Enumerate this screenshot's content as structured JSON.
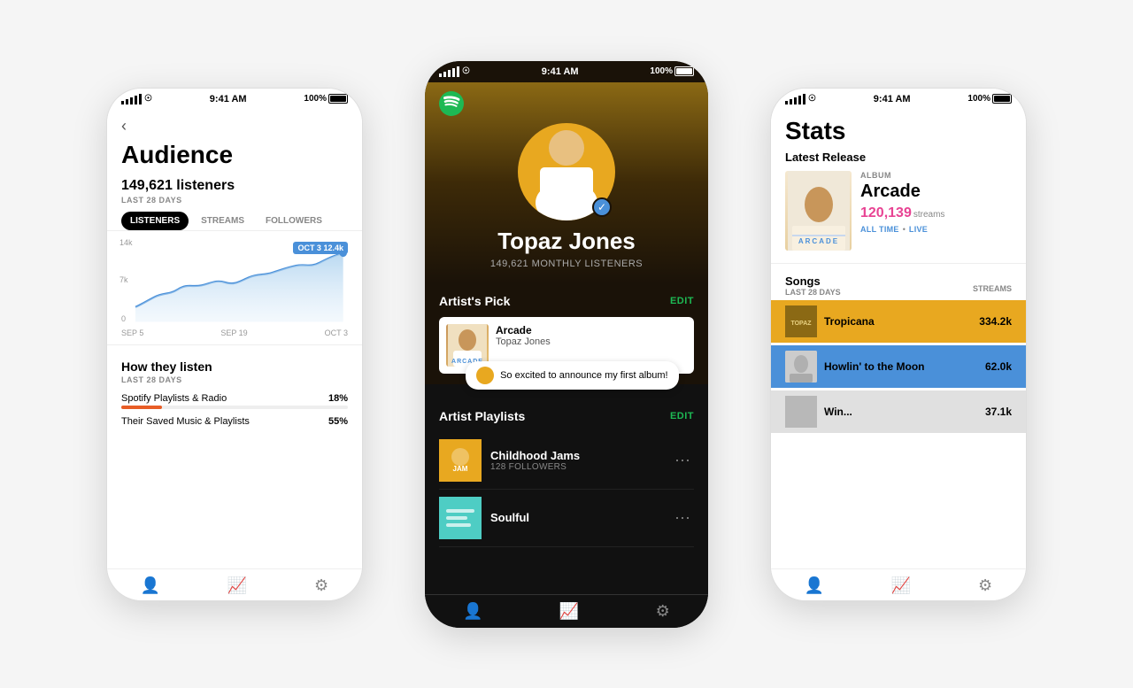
{
  "left_phone": {
    "status_bar": {
      "dots": "•••••",
      "wifi": "wifi",
      "time": "9:41 AM",
      "battery": "100%"
    },
    "back_label": "‹",
    "title": "Audience",
    "listeners_count": "149,621 listeners",
    "last_28_label": "LAST 28 DAYS",
    "tabs": [
      "LISTENERS",
      "STREAMS",
      "FOLLOWERS"
    ],
    "active_tab": "LISTENERS",
    "chart": {
      "y_labels": [
        "14k",
        "7k",
        "0"
      ],
      "x_labels": [
        "SEP 5",
        "SEP 19",
        "OCT 3"
      ],
      "tooltip_date": "OCT 3",
      "tooltip_value": "12.4k"
    },
    "how_they_listen": {
      "title": "How they listen",
      "last_28": "LAST 28 DAYS",
      "items": [
        {
          "label": "Spotify Playlists & Radio",
          "pct": "18%",
          "fill": 18,
          "color": "orange"
        },
        {
          "label": "Their Saved Music & Playlists",
          "pct": "55%",
          "fill": 55,
          "color": "green"
        }
      ]
    },
    "nav": [
      "person",
      "chart",
      "gear"
    ]
  },
  "center_phone": {
    "status_bar": {
      "dots": "•••••",
      "wifi": "wifi",
      "time": "9:41 AM",
      "battery": "100%"
    },
    "artist_name": "Topaz Jones",
    "monthly_listeners": "149,621 MONTHLY LISTENERS",
    "artists_pick": {
      "section_label": "Artist's Pick",
      "edit_label": "EDIT",
      "album_title": "Arcade",
      "album_artist": "Topaz Jones",
      "speech_bubble": "So excited to announce my first album!"
    },
    "playlists": {
      "section_label": "Artist Playlists",
      "edit_label": "EDIT",
      "items": [
        {
          "name": "Childhood Jams",
          "followers": "128 FOLLOWERS",
          "color": "orange"
        },
        {
          "name": "Soulful",
          "followers": "",
          "color": "teal"
        }
      ]
    },
    "nav": [
      "person",
      "chart",
      "gear"
    ]
  },
  "right_phone": {
    "status_bar": {
      "dots": "•••••",
      "wifi": "wifi",
      "time": "9:41 AM",
      "battery": "100%"
    },
    "title": "Stats",
    "latest_release": {
      "heading": "Latest Release",
      "type_label": "ALBUM",
      "album_name": "Arcade",
      "streams_num": "120,139",
      "streams_suffix": " streams",
      "time_label": "ALL TIME",
      "live_label": "LIVE"
    },
    "songs": {
      "heading": "Songs",
      "last_28": "LAST 28 DAYS",
      "streams_col": "STREAMS",
      "items": [
        {
          "title": "Tropicana",
          "streams": "334.2k",
          "bg": "orange"
        },
        {
          "title": "Howlin' to the Moon",
          "streams": "62.0k",
          "bg": "blue"
        },
        {
          "title": "Win...",
          "streams": "37.1k",
          "bg": "grey"
        }
      ]
    },
    "nav": [
      "person",
      "chart",
      "gear"
    ]
  }
}
